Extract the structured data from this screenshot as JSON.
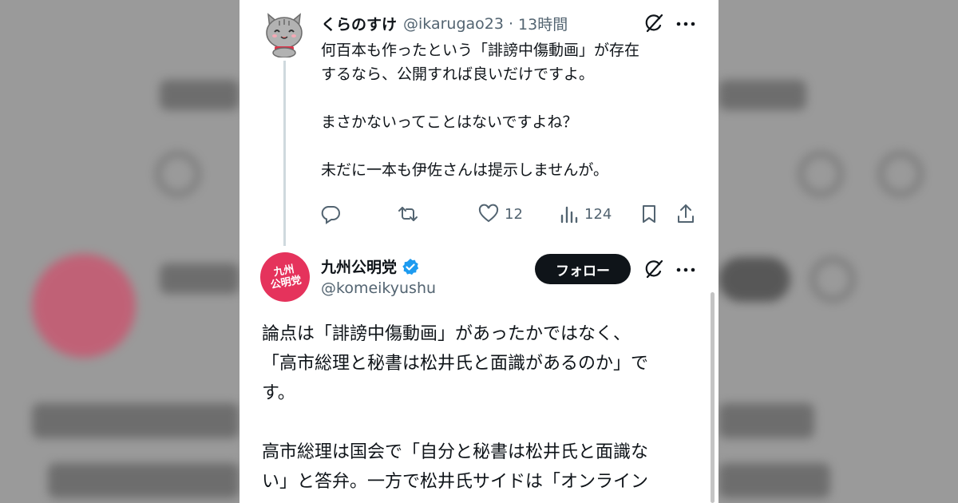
{
  "reply": {
    "author_name": "くらのすけ",
    "handle": "@ikarugao23",
    "separator": "·",
    "time": "13時間",
    "body": "何百本も作ったという「誹謗中傷動画」が存在\nするなら、公開すれば良いだけですよ。\n\nまさかないってことはないですよね？\n\n未だに一本も伊佐さんは提示しませんが。",
    "actions": {
      "reply_icon": "reply-icon",
      "retweet_icon": "retweet-icon",
      "like_icon": "heart-icon",
      "like_count": "12",
      "views_icon": "views-chart-icon",
      "views_count": "124",
      "bookmark_icon": "bookmark-icon",
      "share_icon": "share-icon"
    }
  },
  "quoted": {
    "author_name": "九州公明党",
    "handle": "@komeikyushu",
    "avatar_text_top": "九州",
    "avatar_text_bottom": "公明党",
    "follow_label": "フォロー",
    "body": "論点は「誹謗中傷動画」があったかではなく、\n「高市総理と秘書は松井氏と面識があるのか」で\nす。\n\n高市総理は国会で「自分と秘書は松井氏と面識な\nい」と答弁。一方で松井氏サイドは「オンライン"
  },
  "colors": {
    "text": "#0f1419",
    "muted": "#536471",
    "verified": "#1d9bf0",
    "party_red": "#e5335c",
    "follow_bg": "#0f1419"
  }
}
